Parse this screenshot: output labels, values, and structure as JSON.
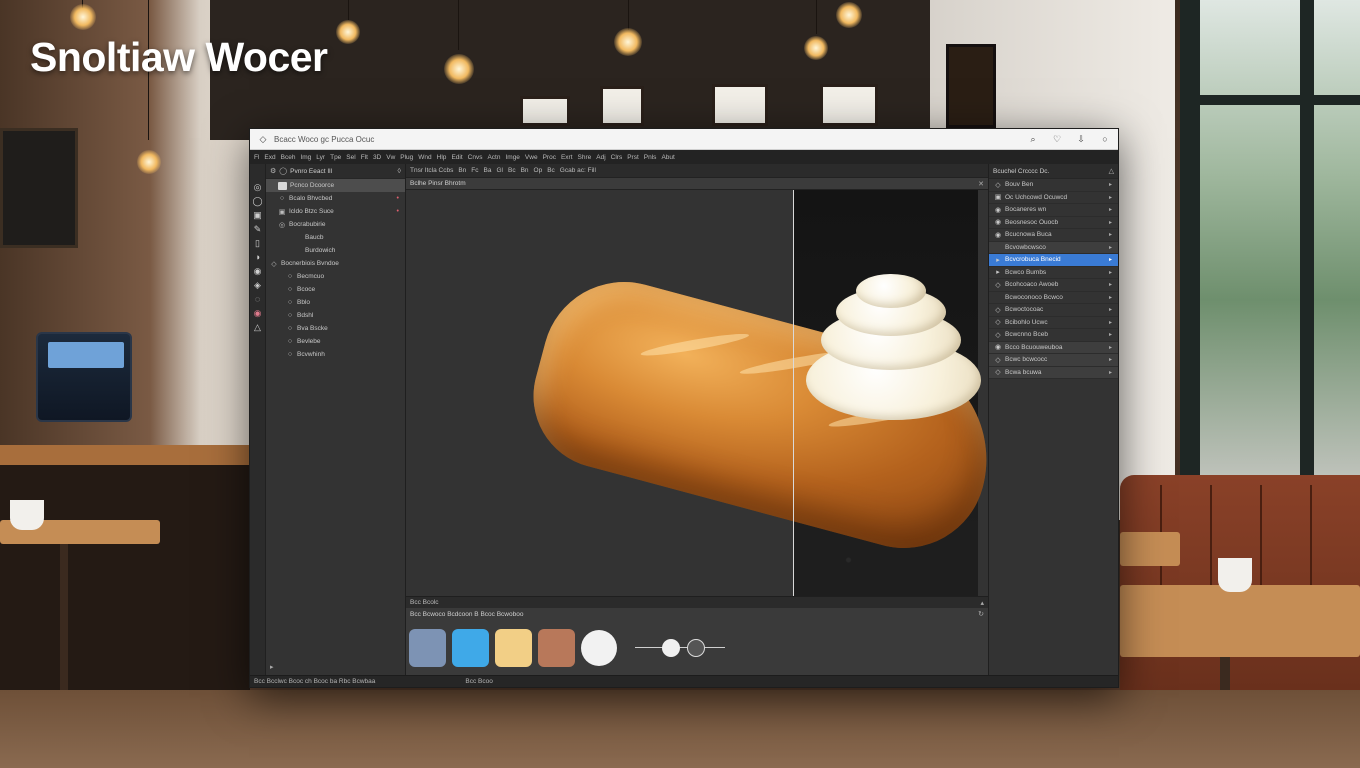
{
  "hero": {
    "title": "Snoltiaw Wocer"
  },
  "window": {
    "title": "Bcacc Woco gc Pucca Ocuc",
    "controls": [
      "⌕",
      "♡",
      "⇩",
      "○"
    ]
  },
  "menu": [
    "Fl",
    "Exd",
    "Bceh",
    "Img",
    "Lyr",
    "Tpe",
    "Sel",
    "Flt",
    "3D",
    "Vw",
    "Plug",
    "Wnd",
    "Hlp",
    "Edit",
    "Cnvs",
    "Actn",
    "Imge",
    "Vwe",
    "Proc",
    "Exrt",
    "Shre",
    "Adj",
    "Clrs",
    "Prst",
    "Pnls",
    "Abut"
  ],
  "options_bar": {
    "items": [
      "Tnsr Itcla Ccbs",
      "Bn",
      "Fc",
      "Ba",
      "Gl",
      "Bc",
      "Bn",
      "Op",
      "Bc",
      "Gcab ac: Fill"
    ]
  },
  "document": {
    "tab": "Bclhe Pinsr Bhrotm",
    "close": "✕"
  },
  "layers": {
    "header": "Pvnro Eeact Ill",
    "items": [
      {
        "label": "Pcnco Dcoorce",
        "indent": 1,
        "icon": "box",
        "selected": true,
        "dot": ""
      },
      {
        "label": "Bcalo Bhvcbed",
        "indent": 1,
        "icon": "○",
        "selected": false,
        "dot": "•"
      },
      {
        "label": "Icldo Btzc Suce",
        "indent": 1,
        "icon": "▣",
        "selected": false,
        "dot": "•"
      },
      {
        "label": "Bocrabubirie",
        "indent": 1,
        "icon": "◎",
        "selected": false,
        "dot": ""
      },
      {
        "label": "Baucb",
        "indent": 3,
        "icon": "",
        "selected": false,
        "dot": ""
      },
      {
        "label": "Burdowich",
        "indent": 3,
        "icon": "",
        "selected": false,
        "dot": ""
      },
      {
        "label": "Bocnerbiois Bvndoe",
        "indent": 0,
        "icon": "◇",
        "selected": false,
        "dot": ""
      },
      {
        "label": "Becmcuo",
        "indent": 2,
        "icon": "○",
        "selected": false,
        "dot": ""
      },
      {
        "label": "Bcoce",
        "indent": 2,
        "icon": "○",
        "selected": false,
        "dot": ""
      },
      {
        "label": "Bblo",
        "indent": 2,
        "icon": "○",
        "selected": false,
        "dot": ""
      },
      {
        "label": "Bdshl",
        "indent": 2,
        "icon": "○",
        "selected": false,
        "dot": ""
      },
      {
        "label": "Bva Bscke",
        "indent": 2,
        "icon": "○",
        "selected": false,
        "dot": ""
      },
      {
        "label": "Bevlebe",
        "indent": 2,
        "icon": "○",
        "selected": false,
        "dot": ""
      },
      {
        "label": "Bcvwhinh",
        "indent": 2,
        "icon": "○",
        "selected": false,
        "dot": ""
      }
    ]
  },
  "properties": {
    "header": "Bcuchel Crcccc Dc.",
    "rows": [
      {
        "label": "Bouv Ben",
        "icon": "◇",
        "style": "normal"
      },
      {
        "label": "Oc Uchcowd Ocuwcd",
        "icon": "▣",
        "style": "normal"
      },
      {
        "label": "Bocaneres wn",
        "icon": "◉",
        "style": "normal"
      },
      {
        "label": "Beosnesoc Ouocb",
        "icon": "◉",
        "style": "normal"
      },
      {
        "label": "Bcucnowa Buca",
        "icon": "◉",
        "style": "normal"
      },
      {
        "label": "Bcvowbcwsco",
        "icon": "",
        "style": "shade"
      },
      {
        "label": "Bcvcrobuca Bnecid",
        "icon": "▸",
        "style": "highlight"
      },
      {
        "label": "Bcwco Bumbs",
        "icon": "▸",
        "style": "normal"
      },
      {
        "label": "Bcohcoaco Awoeb",
        "icon": "◇",
        "style": "normal"
      },
      {
        "label": "Bcwoconoco Bcwco",
        "icon": "",
        "style": "normal"
      },
      {
        "label": "Bcwoctocoac",
        "icon": "◇",
        "style": "normal"
      },
      {
        "label": "Bcibohlo Ucwc",
        "icon": "◇",
        "style": "normal"
      },
      {
        "label": "Bcwcnno Bceb",
        "icon": "◇",
        "style": "normal"
      },
      {
        "label": "Bcco Bcuouweuboa",
        "icon": "◉",
        "style": "shade"
      },
      {
        "label": "Bcwc bcwcocc",
        "icon": "◇",
        "style": "shade"
      },
      {
        "label": "Bcwa bcuwa",
        "icon": "◇",
        "style": "shade"
      }
    ]
  },
  "swatches": {
    "header": "Bcc Bcolc",
    "sub": "Bcc Bcwoco Bcdcoon B Bcoc Bcwoboo",
    "colors": [
      "#7d93b4",
      "#3fa9e8",
      "#f2cf86",
      "#b8785a",
      "#f2f2f2"
    ],
    "slider_value": 0.3
  },
  "status": {
    "left": "Bcc Bcclwc Bcoc ch Bcoc ba Rbc Bcwbaa",
    "mid": "Bcc Bcoo"
  }
}
